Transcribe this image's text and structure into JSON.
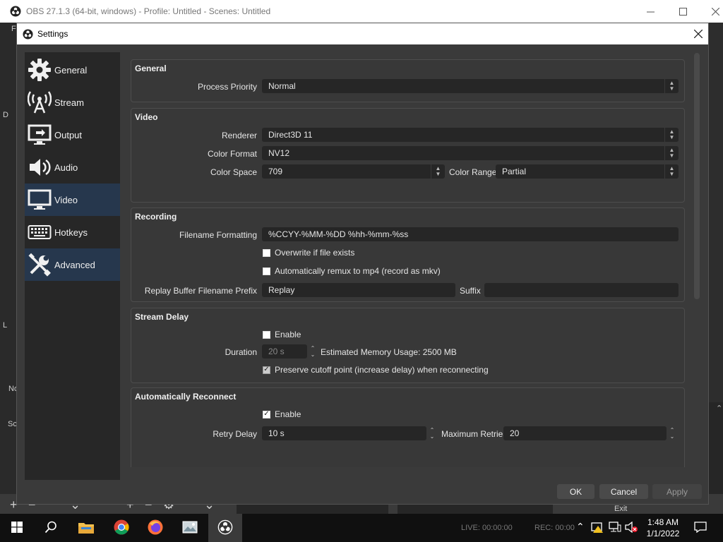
{
  "main_window": {
    "title": "OBS 27.1.3 (64-bit, windows) - Profile: Untitled - Scenes: Untitled",
    "bg_letters": [
      "F",
      "D",
      "L",
      "No",
      "Sc"
    ],
    "exit_label": "Exit",
    "status_live": "LIVE: 00:00:00",
    "status_rec": "REC: 00:00"
  },
  "settings": {
    "title": "Settings",
    "sidebar": [
      {
        "label": "General",
        "icon": "gear-icon"
      },
      {
        "label": "Stream",
        "icon": "antenna-icon"
      },
      {
        "label": "Output",
        "icon": "monitor-output-icon"
      },
      {
        "label": "Audio",
        "icon": "speaker-icon"
      },
      {
        "label": "Video",
        "icon": "monitor-icon"
      },
      {
        "label": "Hotkeys",
        "icon": "keyboard-icon"
      },
      {
        "label": "Advanced",
        "icon": "tools-icon"
      }
    ],
    "active_item": "Advanced",
    "general": {
      "title": "General",
      "process_priority_label": "Process Priority",
      "process_priority_value": "Normal"
    },
    "video": {
      "title": "Video",
      "renderer_label": "Renderer",
      "renderer_value": "Direct3D 11",
      "color_format_label": "Color Format",
      "color_format_value": "NV12",
      "color_space_label": "Color Space",
      "color_space_value": "709",
      "color_range_label": "Color Range",
      "color_range_value": "Partial"
    },
    "recording": {
      "title": "Recording",
      "filename_label": "Filename Formatting",
      "filename_value": "%CCYY-%MM-%DD %hh-%mm-%ss",
      "overwrite_label": "Overwrite if file exists",
      "overwrite_checked": false,
      "remux_label": "Automatically remux to mp4 (record as mkv)",
      "remux_checked": false,
      "replay_prefix_label": "Replay Buffer Filename Prefix",
      "replay_prefix_value": "Replay",
      "suffix_label": "Suffix",
      "suffix_value": ""
    },
    "stream_delay": {
      "title": "Stream Delay",
      "enable_label": "Enable",
      "enable_checked": false,
      "duration_label": "Duration",
      "duration_value": "20 s",
      "memory_usage": "Estimated Memory Usage: 2500 MB",
      "preserve_label": "Preserve cutoff point (increase delay) when reconnecting",
      "preserve_checked": true
    },
    "auto_reconnect": {
      "title": "Automatically Reconnect",
      "enable_label": "Enable",
      "enable_checked": true,
      "retry_delay_label": "Retry Delay",
      "retry_delay_value": "10 s",
      "max_retries_label": "Maximum Retries",
      "max_retries_value": "20"
    },
    "buttons": {
      "ok": "OK",
      "cancel": "Cancel",
      "apply": "Apply"
    }
  },
  "taskbar": {
    "apps": [
      "start-icon",
      "search-icon",
      "file-explorer-icon",
      "chrome-icon",
      "firefox-icon",
      "photos-icon",
      "obs-icon"
    ],
    "active_app": "obs-icon",
    "time": "1:48 AM",
    "date": "1/1/2022"
  },
  "colors": {
    "accent_selected": "#26374d",
    "dialog_bg": "#3a3a3a",
    "field_bg": "#262626",
    "taskbar_bg": "#101010"
  }
}
